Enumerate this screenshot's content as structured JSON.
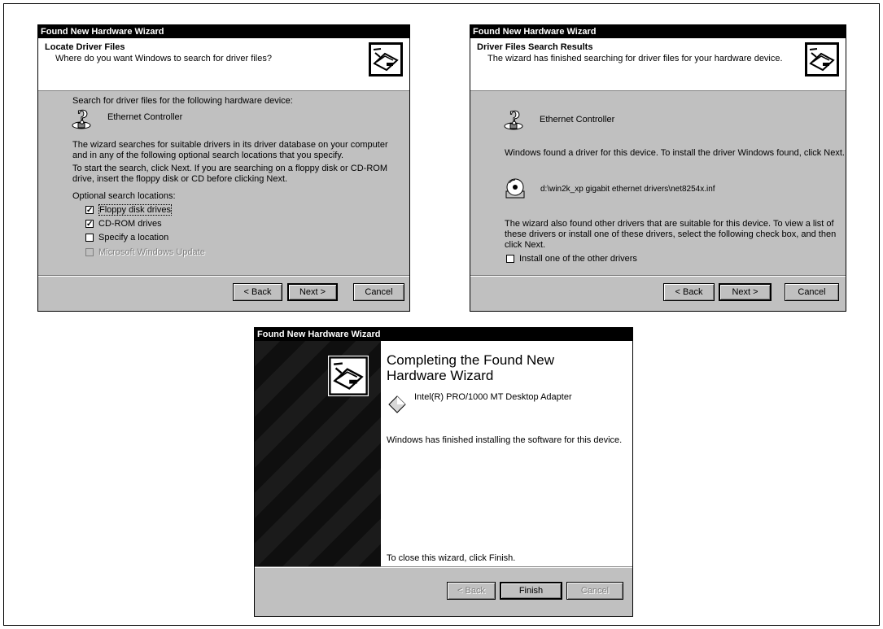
{
  "window1": {
    "title": "Found New Hardware Wizard",
    "header_title": "Locate Driver Files",
    "header_subtitle": "Where do you want Windows to search for driver files?",
    "search_intro": "Search for driver files for the following hardware device:",
    "device_name": "Ethernet Controller",
    "para1": "The wizard searches for suitable drivers in its driver database on your computer and in any of the following optional search locations that you specify.",
    "para2": "To start the search, click Next. If you are searching on a floppy disk or CD-ROM drive, insert the floppy disk or CD before clicking Next.",
    "optional_label": "Optional search locations:",
    "options": [
      {
        "label": "Floppy disk drives",
        "checked": true
      },
      {
        "label": "CD-ROM drives",
        "checked": true
      },
      {
        "label": "Specify a location",
        "checked": false
      },
      {
        "label": "Microsoft Windows Update",
        "checked": false,
        "disabled": true
      }
    ],
    "back_label": "< Back",
    "next_label": "Next >",
    "cancel_label": "Cancel"
  },
  "window2": {
    "title": "Found New Hardware Wizard",
    "header_title": "Driver Files Search Results",
    "header_subtitle": "The wizard has finished searching for driver files for your hardware device.",
    "device_name": "Ethernet Controller",
    "found_text": "Windows found a driver for this device. To install the driver Windows found, click Next.",
    "driver_path": "d:\\win2k_xp gigabit ethernet drivers\\net8254x.inf",
    "other_text": "The wizard also found other drivers that are suitable for this device. To view a list of these drivers or install one of these drivers, select the following check box, and then click Next.",
    "install_other_label": "Install one of the other drivers",
    "back_label": "< Back",
    "next_label": "Next >",
    "cancel_label": "Cancel"
  },
  "window3": {
    "title": "Found New Hardware Wizard",
    "heading": "Completing the Found New Hardware Wizard",
    "device_name": "Intel(R) PRO/1000 MT Desktop Adapter",
    "finished_text": "Windows has finished installing the software for this device.",
    "close_text": "To close this wizard, click Finish.",
    "back_label": "< Back",
    "finish_label": "Finish",
    "cancel_label": "Cancel"
  }
}
